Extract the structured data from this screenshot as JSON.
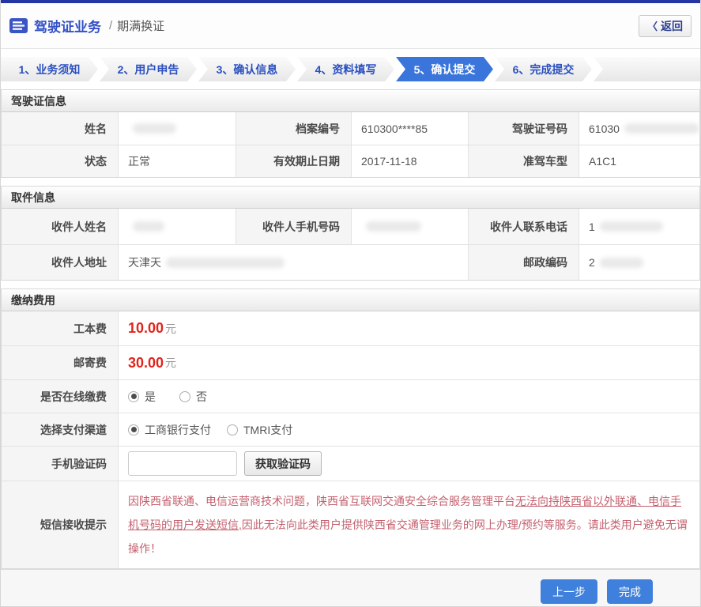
{
  "header": {
    "title": "驾驶证业务",
    "separator": "/",
    "subtitle": "期满换证",
    "back_button": {
      "chevron": "〈",
      "label": "返回"
    }
  },
  "steps": [
    {
      "label": "1、业务须知",
      "active": false
    },
    {
      "label": "2、用户申告",
      "active": false
    },
    {
      "label": "3、确认信息",
      "active": false
    },
    {
      "label": "4、资料填写",
      "active": false
    },
    {
      "label": "5、确认提交",
      "active": true
    },
    {
      "label": "6、完成提交",
      "active": false
    }
  ],
  "license_section": {
    "title": "驾驶证信息",
    "name_label": "姓名",
    "name_value": "",
    "file_number_label": "档案编号",
    "file_number_value": "610300****85",
    "license_number_label": "驾驶证号码",
    "license_number_value": "61030",
    "status_label": "状态",
    "status_value": "正常",
    "valid_until_label": "有效期止日期",
    "valid_until_value": "2017-11-18",
    "vehicle_class_label": "准驾车型",
    "vehicle_class_value": "A1C1"
  },
  "pickup_section": {
    "title": "取件信息",
    "recipient_name_label": "收件人姓名",
    "recipient_name_value": "",
    "recipient_mobile_label": "收件人手机号码",
    "recipient_mobile_value": "",
    "recipient_phone_label": "收件人联系电话",
    "recipient_phone_value": "1",
    "recipient_address_label": "收件人地址",
    "recipient_address_value": "天津天",
    "postal_code_label": "邮政编码",
    "postal_code_value": "2"
  },
  "payment_section": {
    "title": "缴纳费用",
    "production_fee_label": "工本费",
    "production_fee_amount": "10.00",
    "production_fee_unit": "元",
    "mailing_fee_label": "邮寄费",
    "mailing_fee_amount": "30.00",
    "mailing_fee_unit": "元",
    "online_payment_label": "是否在线缴费",
    "online_yes": "是",
    "online_no": "否",
    "channel_label": "选择支付渠道",
    "channel_icbc": "工商银行支付",
    "channel_tmri": "TMRI支付",
    "sms_code_label": "手机验证码",
    "sms_code_value": "",
    "get_code_button": "获取验证码",
    "sms_notice_label": "短信接收提示",
    "sms_notice_part1": "因陕西省联通、电信运营商技术问题，陕西省互联网交通安全综合服务管理平台",
    "sms_notice_underlined": "无法向持陕西省以外联通、电信手机号码的用户发送短信,",
    "sms_notice_part2": "因此无法向此类用户提供陕西省交通管理业务的网上办理/预约等服务。请此类用户避免无谓操作！"
  },
  "footer": {
    "prev_button": "上一步",
    "done_button": "完成"
  },
  "colors": {
    "topbar": "#2336a4",
    "accent_blue": "#3f80dc",
    "active_step": "#3a75db",
    "fee_red": "#e1251b",
    "notice_red": "#c4606e"
  }
}
